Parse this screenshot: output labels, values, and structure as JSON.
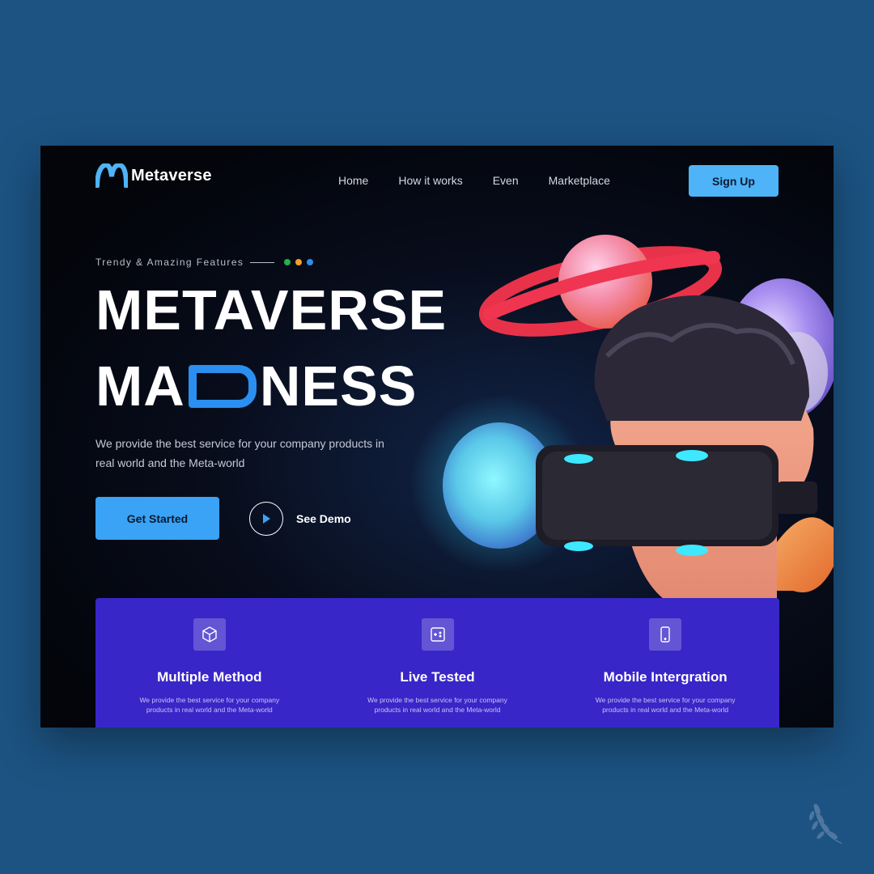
{
  "app": {
    "brand": "Metaverse",
    "brand_color": "#4eb3f7",
    "background_color": "#1c5382"
  },
  "nav": {
    "items": [
      "Home",
      "How it works",
      "Even",
      "Marketplace"
    ],
    "signup_label": "Sign Up"
  },
  "hero": {
    "tagline": "Trendy & Amazing Features",
    "tagline_dot_colors": [
      "#22b14c",
      "#f0a02a",
      "#2a8ff0"
    ],
    "title_line1": "METAVERSE",
    "title_line2_prefix": "MA",
    "title_line2_suffix": "NESS",
    "title_accent_color": "#2a8ff0",
    "description": "We provide the best service for your company products in real world and the Meta-world",
    "primary_cta": "Get Started",
    "secondary_cta": "See Demo"
  },
  "features": [
    {
      "icon": "cube-icon",
      "title": "Multiple Method",
      "description": "We provide the best service for your company products in real world and the Meta-world"
    },
    {
      "icon": "tablet-sparkle-icon",
      "title": "Live Tested",
      "description": "We provide the best service for your company products in real world and the Meta-world"
    },
    {
      "icon": "mobile-phone-icon",
      "title": "Mobile Intergration",
      "description": "We provide the best service for your company products in real world and the Meta-world"
    }
  ],
  "features_panel_color": "#3826c8"
}
